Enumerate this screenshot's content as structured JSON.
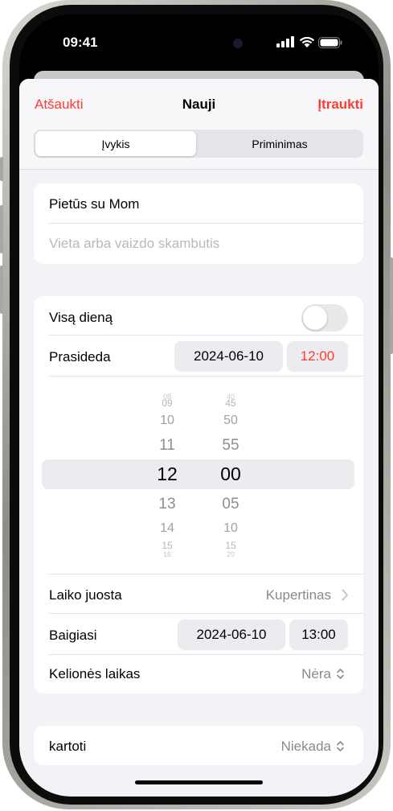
{
  "status_bar": {
    "time": "09:41"
  },
  "nav": {
    "cancel": "Atšaukti",
    "title": "Nauji",
    "add": "Įtraukti"
  },
  "segments": {
    "event": "Įvykis",
    "reminder": "Priminimas",
    "selected": "Įvykis"
  },
  "title_section": {
    "title_value": "Pietūs su Mom",
    "location_placeholder": "Vieta arba vaizdo skambutis"
  },
  "details": {
    "all_day_label": "Visą dieną",
    "all_day_on": false,
    "starts_label": "Prasideda",
    "starts_date": "2024-06-10",
    "starts_time": "12:00",
    "time_picker": {
      "hours": [
        "08",
        "09",
        "10",
        "11",
        "12",
        "13",
        "14",
        "15",
        "16"
      ],
      "minutes": [
        "40",
        "45",
        "50",
        "55",
        "00",
        "05",
        "10",
        "15",
        "20"
      ],
      "selected_hour": "12",
      "selected_minute": "00"
    },
    "timezone_label": "Laiko juosta",
    "timezone_value": "Kupertinas",
    "ends_label": "Baigiasi",
    "ends_date": "2024-06-10",
    "ends_time": "13:00",
    "travel_label": "Kelionės laikas",
    "travel_value": "Nėra"
  },
  "repeat": {
    "label": "kartoti",
    "value": "Niekada"
  },
  "colors": {
    "accent": "#ff3b30",
    "background": "#f2f2f7",
    "card": "#ffffff",
    "secondary_text": "#8a8a8e"
  }
}
